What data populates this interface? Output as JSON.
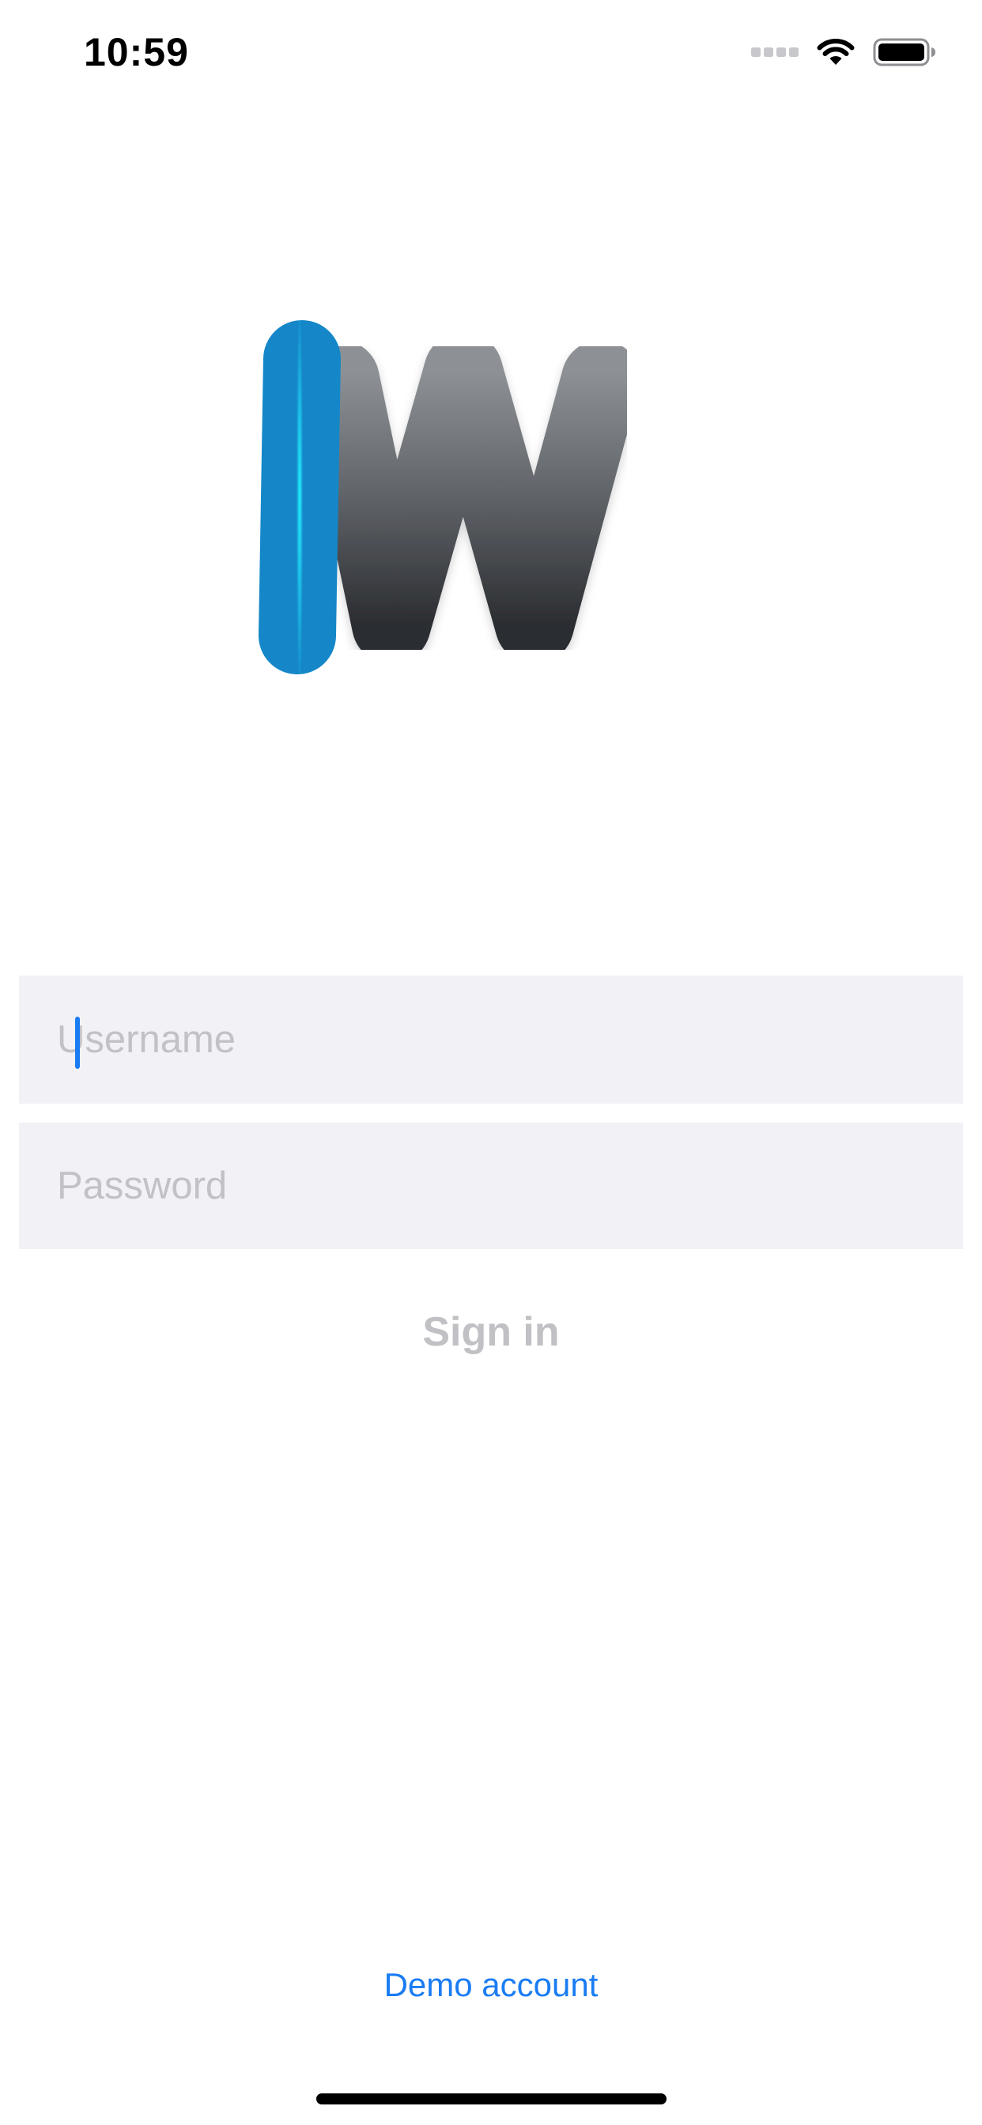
{
  "status_bar": {
    "time": "10:59",
    "icons": [
      "cellular-signal-icon",
      "wifi-icon",
      "battery-icon"
    ]
  },
  "logo": {
    "icon": "app-logo-w-icon",
    "colors": {
      "blue_light": "#22f4fb",
      "blue_dark": "#1587c8",
      "gray_light": "#8d9196",
      "gray_dark": "#2b2d31"
    }
  },
  "login": {
    "username_placeholder": "Username",
    "username_value": "",
    "password_placeholder": "Password",
    "password_value": "",
    "signin_label": "Sign in",
    "demo_account_label": "Demo account"
  },
  "theme": {
    "accent": "#1a7cf3",
    "field_background": "#f1f1f6",
    "placeholder": "#c1c1c7",
    "disabled_text": "#c1c1c5"
  }
}
